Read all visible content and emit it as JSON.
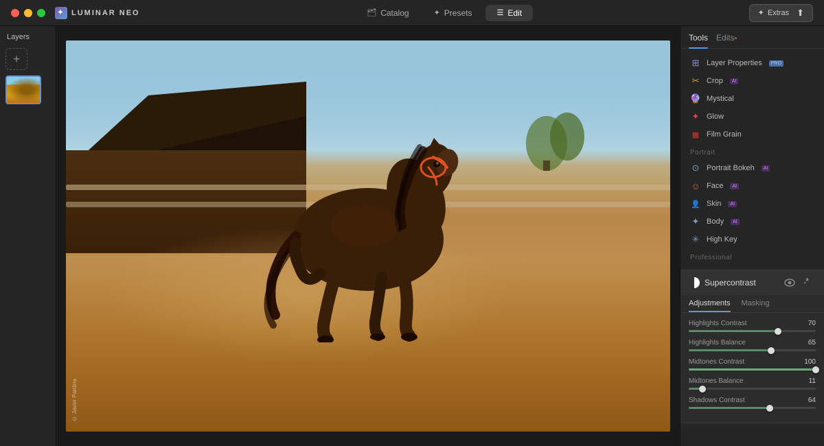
{
  "app": {
    "name": "LUMINAR NEO",
    "logo_char": "✦"
  },
  "titlebar": {
    "nav": {
      "catalog_label": "Catalog",
      "catalog_icon": "🗂",
      "presets_label": "Presets",
      "presets_icon": "✦",
      "edit_label": "Edit",
      "edit_icon": "☰"
    },
    "extras_label": "Extras",
    "extras_icon": "✦"
  },
  "layers": {
    "title": "Layers",
    "add_label": "+"
  },
  "right_panel": {
    "tabs": [
      {
        "id": "tools",
        "label": "Tools",
        "active": true
      },
      {
        "id": "edits",
        "label": "Edits",
        "dot": true
      }
    ],
    "tools": [
      {
        "id": "layer-properties",
        "label": "Layer Properties",
        "icon": "⊞",
        "icon_color": "#9090cc",
        "pro": true
      },
      {
        "id": "crop",
        "label": "Crop",
        "icon": "✂",
        "icon_color": "#cc9944",
        "ai": true
      },
      {
        "id": "mystical",
        "label": "Mystical",
        "icon": "🔮",
        "icon_color": "#bb6688",
        "ai": false
      },
      {
        "id": "glow",
        "label": "Glow",
        "icon": "✦",
        "icon_color": "#dd4444",
        "ai": false
      },
      {
        "id": "film-grain",
        "label": "Film Grain",
        "icon": "▩",
        "icon_color": "#cc3333",
        "ai": false
      }
    ],
    "portrait_section": "Portrait",
    "portrait_tools": [
      {
        "id": "portrait-bokeh",
        "label": "Portrait Bokeh",
        "icon": "⊙",
        "icon_color": "#8899bb",
        "ai": true
      },
      {
        "id": "face",
        "label": "Face",
        "icon": "☺",
        "icon_color": "#bb7733",
        "ai": true
      },
      {
        "id": "skin",
        "label": "Skin",
        "icon": "👤",
        "icon_color": "#cc9966",
        "ai": true
      },
      {
        "id": "body",
        "label": "Body",
        "icon": "✦",
        "icon_color": "#8899bb",
        "ai": true
      },
      {
        "id": "high-key",
        "label": "High Key",
        "icon": "✳",
        "icon_color": "#7799bb",
        "ai": false
      }
    ],
    "professional_section": "Professional",
    "supercontrast": {
      "label": "Supercontrast",
      "icon_type": "half-circle",
      "tabs": [
        {
          "id": "adjustments",
          "label": "Adjustments",
          "active": true
        },
        {
          "id": "masking",
          "label": "Masking",
          "active": false
        }
      ],
      "sliders": [
        {
          "id": "highlights-contrast",
          "label": "Highlights Contrast",
          "value": 70,
          "max": 100,
          "fill_pct": 70
        },
        {
          "id": "highlights-balance",
          "label": "Highlights Balance",
          "value": 65,
          "max": 100,
          "fill_pct": 65
        },
        {
          "id": "midtones-contrast",
          "label": "Midtones Contrast",
          "value": 100,
          "max": 100,
          "fill_pct": 100
        },
        {
          "id": "midtones-balance",
          "label": "Midtones Balance",
          "value": 11,
          "max": 100,
          "fill_pct": 11
        },
        {
          "id": "shadows-contrast",
          "label": "Shadows Contrast",
          "value": 64,
          "max": 100,
          "fill_pct": 64
        }
      ]
    }
  },
  "photo": {
    "credit": "© Javier Pardina"
  }
}
